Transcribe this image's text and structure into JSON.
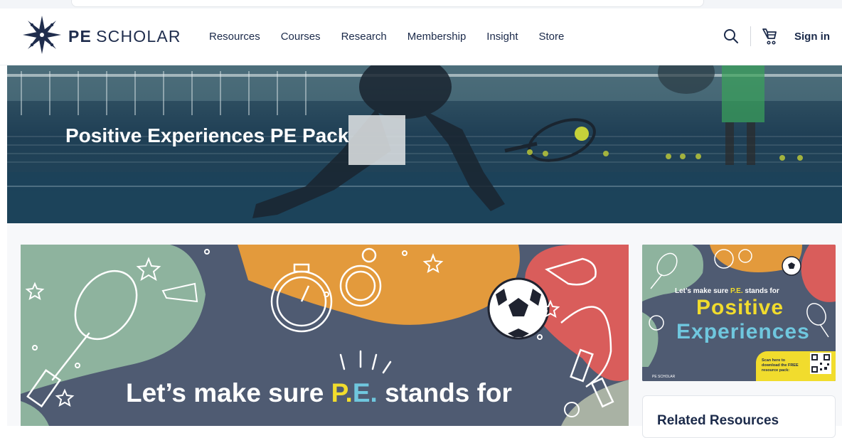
{
  "brand": {
    "bold": "PE",
    "light": "SCHOLAR"
  },
  "nav": {
    "items": [
      "Resources",
      "Courses",
      "Research",
      "Membership",
      "Insight",
      "Store"
    ]
  },
  "header": {
    "sign_in": "Sign in",
    "search_icon": "search-icon",
    "cart_icon": "cart-icon"
  },
  "hero": {
    "title": "Positive Experiences PE Pack"
  },
  "banner": {
    "text_before": "Let’s make sure ",
    "pe": "P.",
    "pe2": "E.",
    "text_after": " stands for"
  },
  "thumbnail": {
    "tagline_before": "Let’s make sure ",
    "tagline_pe": "P.E.",
    "tagline_after": " stands for",
    "word1": "Positive",
    "word2": "Experiences",
    "scan_text": "Scan here to download the FREE resource pack:",
    "credits": "PE SCHOLAR"
  },
  "related": {
    "title": "Related Resources"
  },
  "colors": {
    "navy": "#1b2a4a",
    "banner_bg": "#4f5b72",
    "yellow": "#f1dc2d",
    "blue": "#6fc7de",
    "green": "#8eb39e",
    "orange": "#e39a3c",
    "red": "#d95d5b"
  }
}
